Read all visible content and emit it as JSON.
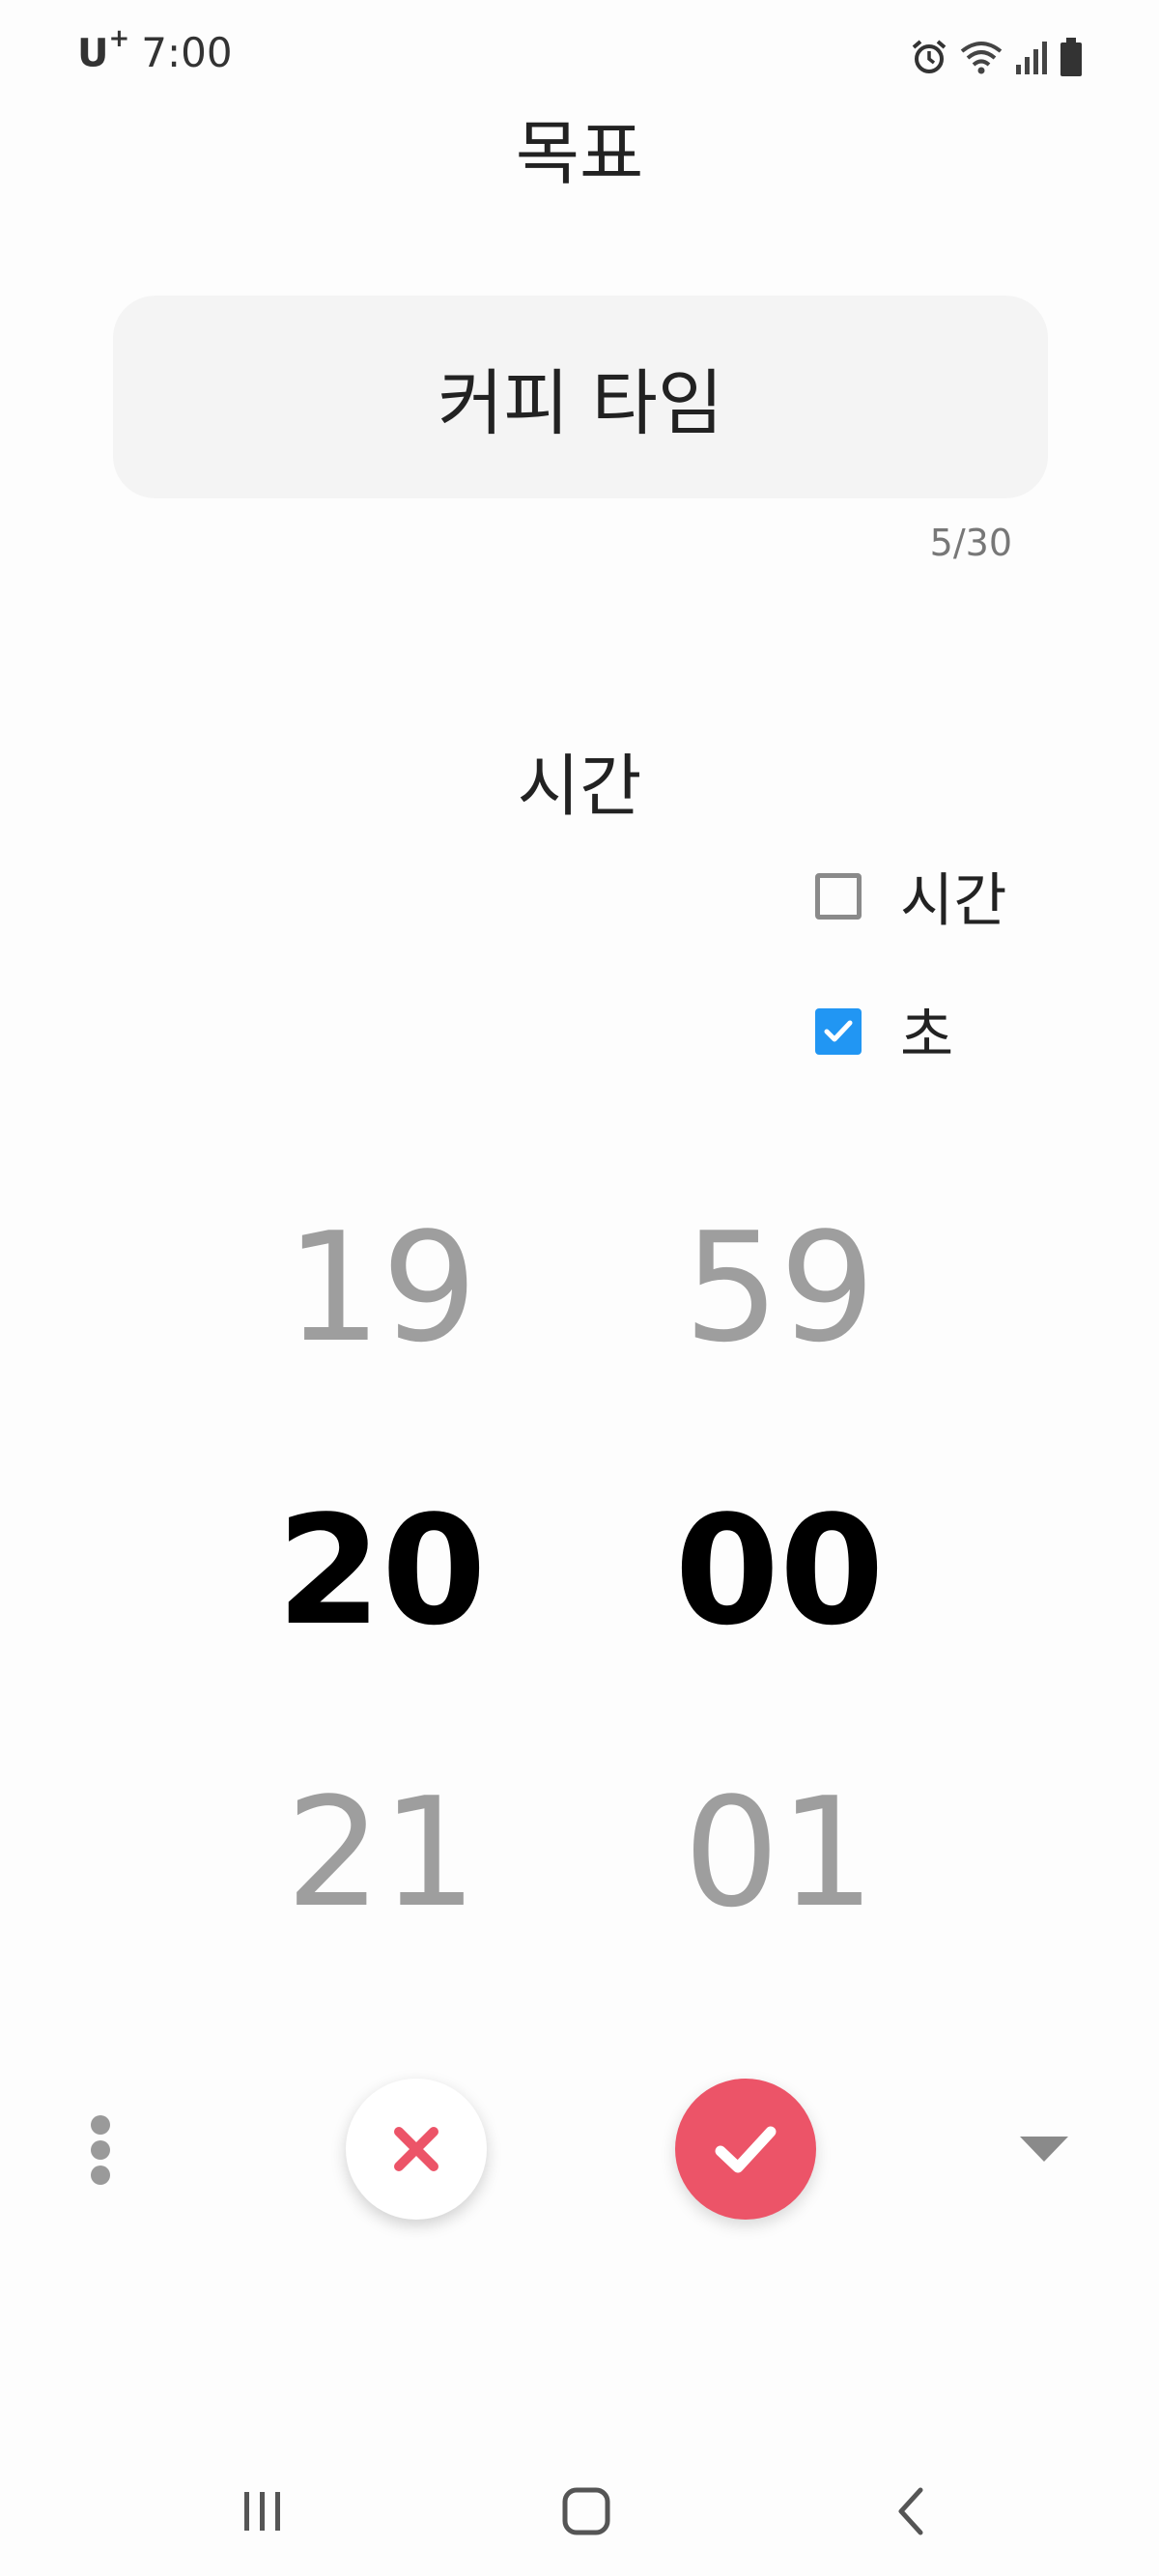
{
  "status_bar": {
    "carrier": "U",
    "carrier_plus": "+",
    "time": "7:00",
    "icons": [
      "alarm-icon",
      "wifi-icon",
      "signal-icon",
      "battery-icon"
    ]
  },
  "header": {
    "title": "목표"
  },
  "goal": {
    "value": "커피 타임",
    "count": "5/30"
  },
  "time_section": {
    "title": "시간",
    "options": [
      {
        "label": "시간",
        "checked": false
      },
      {
        "label": "초",
        "checked": true
      }
    ]
  },
  "picker": {
    "column1": {
      "prev": "19",
      "selected": "20",
      "next": "21"
    },
    "column2": {
      "prev": "59",
      "selected": "00",
      "next": "01"
    }
  },
  "actions": {
    "icons": [
      "more-vert-icon",
      "close-icon",
      "check-icon",
      "dropdown-arrow-icon"
    ]
  },
  "colors": {
    "accent": "#ec5468",
    "checkbox": "#2196f3",
    "dim_number": "#9e9e9e"
  },
  "nav_bar": {
    "icons": [
      "recent-apps-icon",
      "home-icon",
      "back-icon"
    ]
  }
}
